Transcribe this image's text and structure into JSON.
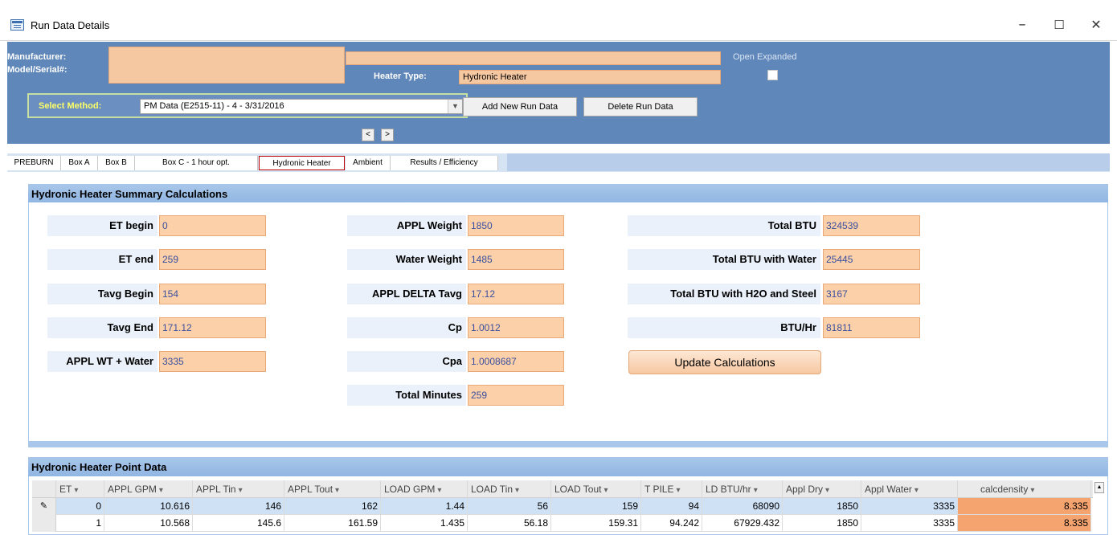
{
  "window": {
    "title": "Run Data Details",
    "minimize": "–",
    "maximize": "☐",
    "close": "✕"
  },
  "header": {
    "manufacturer_label": "Manufacturer:",
    "manufacturer_value": "",
    "model_label": "Model/Serial#:",
    "model_value": "",
    "heater_type_label": "Heater Type:",
    "heater_type_value": "Hydronic Heater",
    "open_expanded_label": "Open Expanded",
    "open_expanded_checked": false,
    "select_method_label": "Select Method:",
    "select_method_value": "PM Data (E2515-11) - 4 - 3/31/2016",
    "add_button": "Add New Run Data",
    "delete_button": "Delete Run Data",
    "prev_button": "<",
    "next_button": ">"
  },
  "tabs": [
    {
      "label": "PREBURN",
      "active": false
    },
    {
      "label": "Box A",
      "active": false
    },
    {
      "label": "Box B",
      "active": false
    },
    {
      "label": "Box C - 1 hour opt.",
      "active": false
    },
    {
      "label": "Hydronic Heater",
      "active": true
    },
    {
      "label": "Ambient",
      "active": false
    },
    {
      "label": "Results / Efficiency",
      "active": false
    }
  ],
  "summary": {
    "title": "Hydronic Heater Summary Calculations",
    "col1": [
      {
        "label": "ET begin",
        "value": "0"
      },
      {
        "label": "ET end",
        "value": "259"
      },
      {
        "label": "Tavg Begin",
        "value": "154"
      },
      {
        "label": "Tavg End",
        "value": "171.12"
      },
      {
        "label": "APPL WT + Water",
        "value": "3335"
      }
    ],
    "col2": [
      {
        "label": "APPL Weight",
        "value": "1850"
      },
      {
        "label": "Water Weight",
        "value": "1485"
      },
      {
        "label": "APPL DELTA Tavg",
        "value": "17.12"
      },
      {
        "label": "Cp",
        "value": "1.0012"
      },
      {
        "label": "Cpa",
        "value": "1.0008687"
      },
      {
        "label": "Total Minutes",
        "value": "259"
      }
    ],
    "col3": [
      {
        "label": "Total BTU",
        "value": "324539"
      },
      {
        "label": "Total BTU with Water",
        "value": "25445"
      },
      {
        "label": "Total BTU with H2O and Steel",
        "value": "3167"
      },
      {
        "label": "BTU/Hr",
        "value": "81811"
      }
    ],
    "update_button": "Update Calculations"
  },
  "point_data": {
    "title": "Hydronic Heater Point Data",
    "columns": [
      "ET",
      "APPL GPM",
      "APPL Tin",
      "APPL Tout",
      "LOAD GPM",
      "LOAD Tin",
      "LOAD Tout",
      "T PILE",
      "LD BTU/hr",
      "Appl Dry",
      "Appl Water",
      "calcdensity"
    ],
    "sort_arrow": "▾",
    "rows": [
      {
        "selector": "✎",
        "cells": [
          "0",
          "10.616",
          "146",
          "162",
          "1.44",
          "56",
          "159",
          "94",
          "68090",
          "1850",
          "3335",
          "8.335"
        ]
      },
      {
        "selector": "",
        "cells": [
          "1",
          "10.568",
          "145.6",
          "161.59",
          "1.435",
          "56.18",
          "159.31",
          "94.242",
          "67929.432",
          "1850",
          "3335",
          "8.335"
        ]
      }
    ]
  },
  "colors": {
    "header_blue": "#5f87b9",
    "field_peach": "#fcd0a8",
    "section_header": "#a9c7ea",
    "calcdensity_orange": "#f5a470",
    "active_tab_border": "#c00000"
  }
}
